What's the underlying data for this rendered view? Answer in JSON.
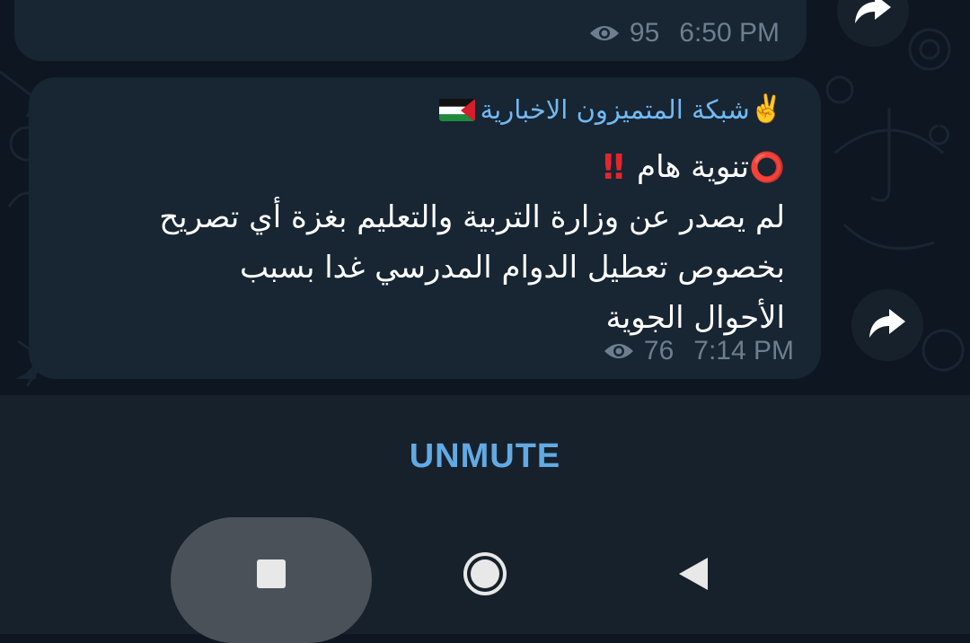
{
  "colors": {
    "background": "#0e1621",
    "bubble": "#182533",
    "sender_name": "#71baf2",
    "meta_text": "#6d7f8f",
    "unmute": "#62aae4",
    "bar": "#17212b"
  },
  "previous_message": {
    "views": "95",
    "time": "6:50 PM",
    "share_icon": "forward-arrow-icon"
  },
  "message": {
    "sender": "شبكة المتميزون الاخبارية",
    "sender_emoji": "✌️",
    "sender_flag": "palestine-flag",
    "title": "تنوية هام",
    "title_icon_before": "⭕",
    "title_icon_after": "‼️",
    "lines": [
      "لم يصدر عن وزارة التربية والتعليم بغزة أي تصريح",
      "بخصوص تعطيل الدوام المدرسي غدا بسبب",
      "الأحوال الجوية"
    ],
    "views": "76",
    "time": "7:14 PM",
    "share_icon": "forward-arrow-icon"
  },
  "bottom_bar": {
    "unmute_label": "UNMUTE"
  },
  "nav": {
    "recents_icon": "square-icon",
    "home_icon": "circle-icon",
    "back_icon": "triangle-back-icon"
  }
}
